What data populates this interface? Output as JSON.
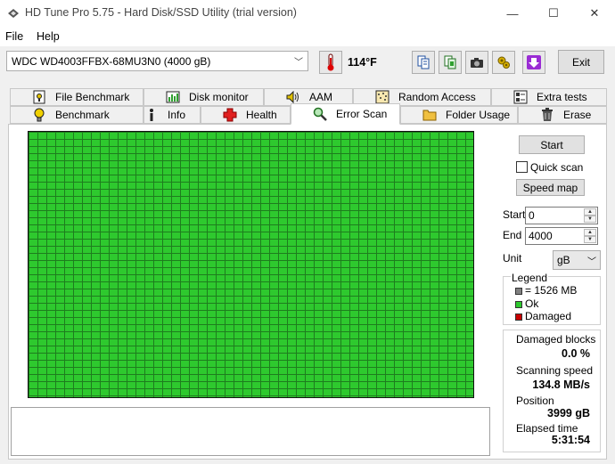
{
  "window": {
    "title": "HD Tune Pro 5.75 - Hard Disk/SSD Utility (trial version)",
    "minimize_glyph": "—",
    "maximize_glyph": "☐",
    "close_glyph": "✕"
  },
  "menu": {
    "file": "File",
    "help": "Help"
  },
  "toolbar": {
    "drive": "WDC WD4003FFBX-68MU3N0 (4000 gB)",
    "temperature": "114°F",
    "exit_label": "Exit",
    "icons": [
      "copy-info-icon",
      "copy-screenshot-icon",
      "camera-icon",
      "options-icon",
      "save-icon"
    ]
  },
  "tabs": {
    "row1": [
      "File Benchmark",
      "Disk monitor",
      "AAM",
      "Random Access",
      "Extra tests"
    ],
    "row2": [
      "Benchmark",
      "Info",
      "Health",
      "Error Scan",
      "Folder Usage",
      "Erase"
    ],
    "active": "Error Scan"
  },
  "controls": {
    "start_label": "Start",
    "quick_scan_label": "Quick scan",
    "quick_scan_checked": false,
    "speed_map_label": "Speed map",
    "start_field_label": "Start",
    "start_value": "0",
    "end_field_label": "End",
    "end_value": "4000",
    "unit_label": "Unit",
    "unit_value": "gB"
  },
  "legend": {
    "title": "Legend",
    "block_size": "= 1526 MB",
    "ok": "Ok",
    "damaged": "Damaged",
    "colors": {
      "block": "#808080",
      "ok": "#2ec92e",
      "damaged": "#c80000"
    }
  },
  "stats": {
    "damaged_blocks_label": "Damaged blocks",
    "damaged_blocks_value": "0.0 %",
    "scanning_speed_label": "Scanning speed",
    "scanning_speed_value": "134.8 MB/s",
    "position_label": "Position",
    "position_value": "3999 gB",
    "elapsed_label": "Elapsed time",
    "elapsed_value": "5:31:54"
  },
  "scan_grid": {
    "block_status": "ok",
    "damaged_blocks": 0
  }
}
